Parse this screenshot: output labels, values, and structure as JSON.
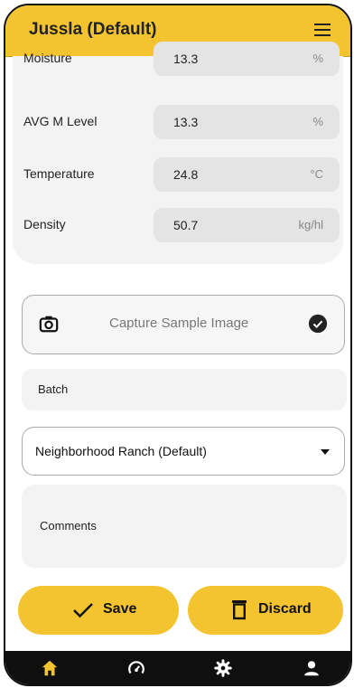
{
  "app": {
    "title": "Jussla (Default)"
  },
  "measurements": [
    {
      "label": "Moisture",
      "value": "13.3",
      "unit": "%"
    },
    {
      "label": "AVG M Level",
      "value": "13.3",
      "unit": "%"
    },
    {
      "label": "Temperature",
      "value": "24.8",
      "unit": "°C"
    },
    {
      "label": "Density",
      "value": "50.7",
      "unit": "kg/hl"
    }
  ],
  "capture": {
    "label": "Capture Sample Image"
  },
  "batch": {
    "label": "Batch"
  },
  "farm": {
    "selected": "Neighborhood Ranch (Default)"
  },
  "comments": {
    "label": "Comments"
  },
  "actions": {
    "save": "Save",
    "discard": "Discard"
  },
  "nav": [
    "home-icon",
    "gauge-icon",
    "settings-icon",
    "profile-icon"
  ],
  "colors": {
    "accent": "#f4c430",
    "bar": "#0f0f0f"
  }
}
